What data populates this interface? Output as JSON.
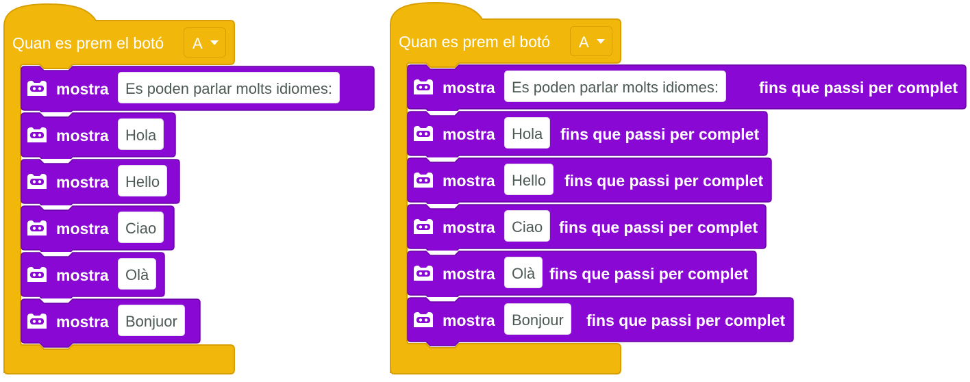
{
  "colors": {
    "event_block": "#f1b80b",
    "event_border": "#d99f00",
    "display_block": "#8a08d4",
    "display_border": "#6a04a6",
    "text_color": "#ffffff",
    "input_text": "#4c5a53"
  },
  "scripts": [
    {
      "hat_label": "Quan es prem el botó",
      "button_value": "A",
      "blocks": [
        {
          "icon": "robot-face-icon",
          "verb": "mostra",
          "text": "Es poden parlar molts idiomes:"
        },
        {
          "icon": "robot-face-icon",
          "verb": "mostra",
          "text": "Hola"
        },
        {
          "icon": "robot-face-icon",
          "verb": "mostra",
          "text": "Hello"
        },
        {
          "icon": "robot-face-icon",
          "verb": "mostra",
          "text": "Ciao"
        },
        {
          "icon": "robot-face-icon",
          "verb": "mostra",
          "text": "Olà"
        },
        {
          "icon": "robot-face-icon",
          "verb": "mostra",
          "text": "Bonjuor"
        }
      ]
    },
    {
      "hat_label": "Quan es prem el botó",
      "button_value": "A",
      "blocks": [
        {
          "icon": "robot-face-icon",
          "verb": "mostra",
          "text": "Es poden parlar molts idiomes:",
          "suffix": "fins que passi per complet"
        },
        {
          "icon": "robot-face-icon",
          "verb": "mostra",
          "text": "Hola",
          "suffix": "fins que passi per complet"
        },
        {
          "icon": "robot-face-icon",
          "verb": "mostra",
          "text": "Hello",
          "suffix": "fins que passi per complet"
        },
        {
          "icon": "robot-face-icon",
          "verb": "mostra",
          "text": "Ciao",
          "suffix": "fins que passi per complet"
        },
        {
          "icon": "robot-face-icon",
          "verb": "mostra",
          "text": "Olà",
          "suffix": "fins que passi per complet"
        },
        {
          "icon": "robot-face-icon",
          "verb": "mostra",
          "text": "Bonjour",
          "suffix": "fins que passi per complet"
        }
      ]
    }
  ]
}
